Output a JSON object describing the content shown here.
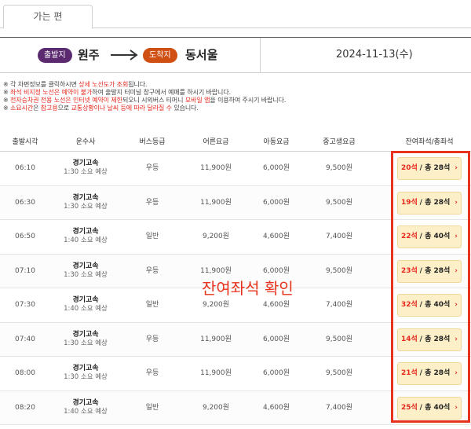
{
  "tab": {
    "label": "가는 편"
  },
  "route": {
    "departure_badge": "출발지",
    "departure_city": "원주",
    "arrival_badge": "도착지",
    "arrival_city": "동서울",
    "date": "2024-11-13(수)"
  },
  "notes": [
    {
      "parts": [
        {
          "t": "※ 각 차편정보를 클릭하시면 "
        },
        {
          "t": "상세 노선도가 조회",
          "red": true
        },
        {
          "t": "됩니다."
        }
      ]
    },
    {
      "parts": [
        {
          "t": "※ "
        },
        {
          "t": "좌석 비지정 노선은 예약이 불가",
          "red": true
        },
        {
          "t": "하여 출발지 터미널 창구에서 예매를 하시기 바랍니다."
        }
      ]
    },
    {
      "parts": [
        {
          "t": "※ "
        },
        {
          "t": "전자승차권 전용 노선은 인터넷 예약이 제한",
          "red": true
        },
        {
          "t": "되오니 시외버스 티머니 "
        },
        {
          "t": "모바일 앱",
          "red": true
        },
        {
          "t": "을 이용하여 주시기 바랍니다."
        }
      ]
    },
    {
      "parts": [
        {
          "t": "※ "
        },
        {
          "t": "소요시간",
          "red": true
        },
        {
          "t": "은 "
        },
        {
          "t": "참고용",
          "red": true
        },
        {
          "t": "으로 "
        },
        {
          "t": "교통상황이나 날씨 등에 따라 달라질 수",
          "red": true
        },
        {
          "t": " 있습니다."
        }
      ]
    }
  ],
  "table": {
    "headers": [
      "출발시각",
      "운수사",
      "버스등급",
      "어른요금",
      "아동요금",
      "중고생요금",
      "잔여좌석/총좌석"
    ],
    "rows": [
      {
        "time": "06:10",
        "company": "경기고속",
        "duration": "1:30 소요 예상",
        "grade": "우등",
        "adult": "11,900원",
        "child": "6,000원",
        "student": "9,500원",
        "remaining": "20석",
        "total": "/ 총 28석"
      },
      {
        "time": "06:30",
        "company": "경기고속",
        "duration": "1:30 소요 예상",
        "grade": "우등",
        "adult": "11,900원",
        "child": "6,000원",
        "student": "9,500원",
        "remaining": "19석",
        "total": "/ 총 28석"
      },
      {
        "time": "06:50",
        "company": "경기고속",
        "duration": "1:40 소요 예상",
        "grade": "일반",
        "adult": "9,200원",
        "child": "4,600원",
        "student": "7,400원",
        "remaining": "22석",
        "total": "/ 총 40석"
      },
      {
        "time": "07:10",
        "company": "경기고속",
        "duration": "1:30 소요 예상",
        "grade": "우등",
        "adult": "11,900원",
        "child": "6,000원",
        "student": "9,500원",
        "remaining": "23석",
        "total": "/ 총 28석"
      },
      {
        "time": "07:30",
        "company": "경기고속",
        "duration": "1:40 소요 예상",
        "grade": "일반",
        "adult": "9,200원",
        "child": "4,600원",
        "student": "7,400원",
        "remaining": "32석",
        "total": "/ 총 40석"
      },
      {
        "time": "07:40",
        "company": "경기고속",
        "duration": "1:30 소요 예상",
        "grade": "우등",
        "adult": "11,900원",
        "child": "6,000원",
        "student": "9,500원",
        "remaining": "14석",
        "total": "/ 총 28석"
      },
      {
        "time": "08:00",
        "company": "경기고속",
        "duration": "1:30 소요 예상",
        "grade": "우등",
        "adult": "11,900원",
        "child": "6,000원",
        "student": "9,500원",
        "remaining": "21석",
        "total": "/ 총 28석"
      },
      {
        "time": "08:20",
        "company": "경기고속",
        "duration": "1:40 소요 예상",
        "grade": "일반",
        "adult": "9,200원",
        "child": "4,600원",
        "student": "7,400원",
        "remaining": "25석",
        "total": "/ 총 40석"
      }
    ]
  },
  "annotation": "잔여좌석 확인",
  "colors": {
    "accent_red": "#e8331c",
    "departure_badge": "#5b2a6f",
    "arrival_badge": "#d04f12",
    "seat_button_bg": "#fdf0c8"
  },
  "icons": {
    "route_arrow": "arrow-right-icon",
    "seat_chevron": "chevron-right-icon"
  }
}
